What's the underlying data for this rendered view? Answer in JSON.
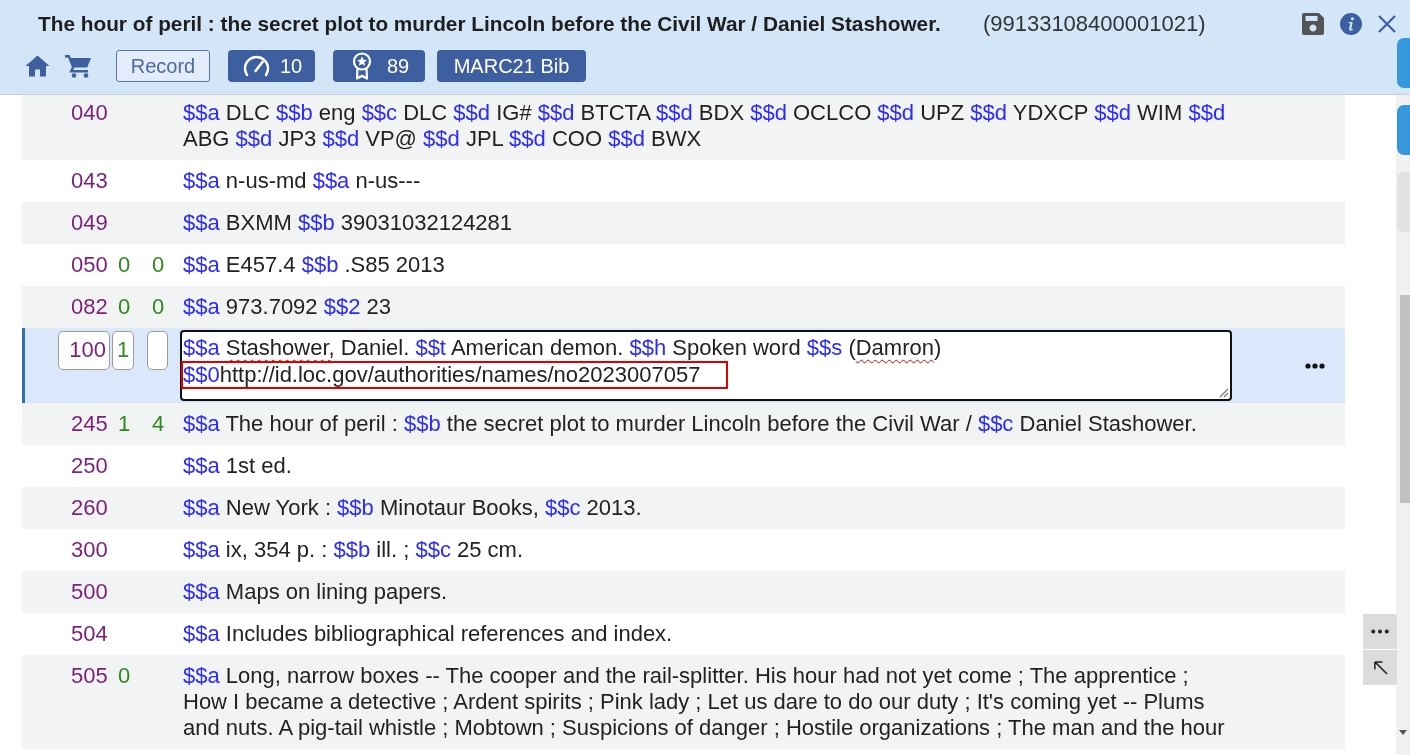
{
  "header": {
    "title": "The hour of peril : the secret plot to murder Lincoln before the Civil War / Daniel Stashower.",
    "record_id": "(99133108400001021)",
    "record_button": "Record",
    "badges": [
      {
        "kind": "gauge",
        "label": "10"
      },
      {
        "kind": "award",
        "label": "89"
      },
      {
        "kind": "text",
        "label": "MARC21 Bib"
      }
    ]
  },
  "side_tabs": [
    {
      "kind": "accent"
    },
    {
      "kind": "accent"
    },
    {
      "kind": "plain"
    }
  ],
  "fields": [
    {
      "kind": "field",
      "tag": "040",
      "subfields": [
        {
          "code": "$$a",
          "text": "DLC"
        },
        {
          "code": "$$b",
          "text": "eng"
        },
        {
          "code": "$$c",
          "text": "DLC"
        },
        {
          "code": "$$d",
          "text": "IG#"
        },
        {
          "code": "$$d",
          "text": "BTCTA"
        },
        {
          "code": "$$d",
          "text": "BDX"
        },
        {
          "code": "$$d",
          "text": "OCLCO"
        },
        {
          "code": "$$d",
          "text": "UPZ"
        },
        {
          "code": "$$d",
          "text": "YDXCP"
        },
        {
          "code": "$$d",
          "text": "WIM"
        },
        {
          "code": "$$d",
          "text": "ABG"
        },
        {
          "code": "$$d",
          "text": "JP3"
        },
        {
          "code": "$$d",
          "text": "VP@"
        },
        {
          "code": "$$d",
          "text": "JPL"
        },
        {
          "code": "$$d",
          "text": "COO"
        },
        {
          "code": "$$d",
          "text": "BWX"
        }
      ]
    },
    {
      "kind": "field",
      "tag": "043",
      "subfields": [
        {
          "code": "$$a",
          "text": "n-us-md"
        },
        {
          "code": "$$a",
          "text": "n-us---"
        }
      ]
    },
    {
      "kind": "field",
      "tag": "049",
      "subfields": [
        {
          "code": "$$a",
          "text": "BXMM"
        },
        {
          "code": "$$b",
          "text": "39031032124281"
        }
      ]
    },
    {
      "kind": "field",
      "tag": "050",
      "ind1": "0",
      "ind2": "0",
      "subfields": [
        {
          "code": "$$a",
          "text": "E457.4"
        },
        {
          "code": "$$b",
          "text": ".S85 2013"
        }
      ]
    },
    {
      "kind": "field",
      "tag": "082",
      "ind1": "0",
      "ind2": "0",
      "subfields": [
        {
          "code": "$$a",
          "text": "973.7092"
        },
        {
          "code": "$$2",
          "text": "23"
        }
      ]
    },
    {
      "kind": "editor",
      "tag": "100",
      "ind1": "1",
      "subfields": [
        {
          "code": "$$a",
          "joined": false,
          "highlighted": false,
          "parts": [
            {
              "text": "Stashower,",
              "misspelled": true
            },
            {
              "text": " Daniel.",
              "misspelled": false
            }
          ]
        },
        {
          "code": "$$t",
          "joined": false,
          "highlighted": false,
          "parts": [
            {
              "text": "American demon.",
              "misspelled": false
            }
          ]
        },
        {
          "code": "$$h",
          "joined": false,
          "highlighted": false,
          "parts": [
            {
              "text": "Spoken word",
              "misspelled": false
            }
          ]
        },
        {
          "code": "$$s",
          "joined": false,
          "highlighted": false,
          "parts": [
            {
              "text": "(",
              "misspelled": false
            },
            {
              "text": "Damron",
              "misspelled": true
            },
            {
              "text": ")",
              "misspelled": false
            }
          ]
        },
        {
          "code": "$$0",
          "joined": true,
          "highlighted": true,
          "parts": [
            {
              "text": "http://id.loc.gov/authorities/names/no2023007057",
              "misspelled": false
            }
          ]
        }
      ]
    },
    {
      "kind": "field",
      "tag": "245",
      "ind1": "1",
      "ind2": "4",
      "subfields": [
        {
          "code": "$$a",
          "text": "The hour of peril :"
        },
        {
          "code": "$$b",
          "text": "the secret plot to murder Lincoln before the Civil War /"
        },
        {
          "code": "$$c",
          "text": "Daniel Stashower."
        }
      ]
    },
    {
      "kind": "field",
      "tag": "250",
      "subfields": [
        {
          "code": "$$a",
          "text": "1st ed."
        }
      ]
    },
    {
      "kind": "field",
      "tag": "260",
      "subfields": [
        {
          "code": "$$a",
          "text": "New York :"
        },
        {
          "code": "$$b",
          "text": "Minotaur Books,"
        },
        {
          "code": "$$c",
          "text": "2013."
        }
      ]
    },
    {
      "kind": "field",
      "tag": "300",
      "subfields": [
        {
          "code": "$$a",
          "text": "ix, 354 p. :"
        },
        {
          "code": "$$b",
          "text": "ill. ;"
        },
        {
          "code": "$$c",
          "text": "25 cm."
        }
      ]
    },
    {
      "kind": "field",
      "tag": "500",
      "subfields": [
        {
          "code": "$$a",
          "text": "Maps on lining papers."
        }
      ]
    },
    {
      "kind": "field",
      "tag": "504",
      "subfields": [
        {
          "code": "$$a",
          "text": "Includes bibliographical references and index."
        }
      ]
    },
    {
      "kind": "field",
      "tag": "505",
      "ind1": "0",
      "subfields": [
        {
          "code": "$$a",
          "text": "Long, narrow boxes -- The cooper and the rail-splitter. His hour had not yet come ; The apprentice ; How I became a detective ; Ardent spirits ; Pink lady ; Let us dare to do our duty ; It's coming yet -- Plums and nuts. A pig-tail whistle ; Mobtown ; Suspicions of danger ; Hostile organizations ; The man and the hour"
        }
      ]
    }
  ]
}
